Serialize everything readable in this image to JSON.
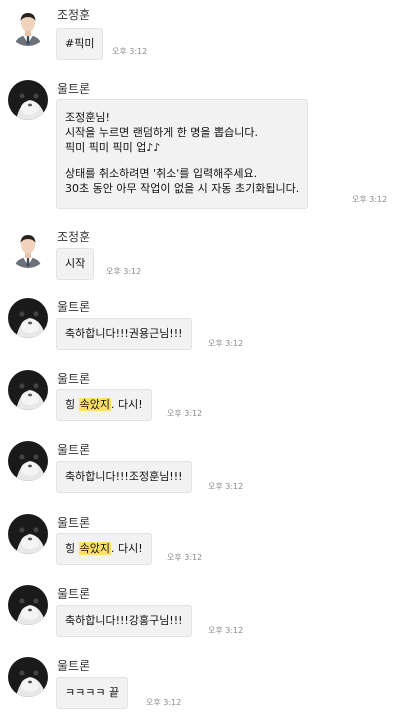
{
  "messages": [
    {
      "sender": "조정훈",
      "text": "#픽미",
      "time": "오후 3:12"
    },
    {
      "sender": "울트론",
      "lines": [
        "조정훈님!",
        "시작을 누르면 랜덤하게 한 명을 뽑습니다.",
        "픽미 픽미 픽미 업♪♪",
        "",
        "상태를 취소하려면 '취소'를 입력해주세요.",
        "30초 동안 아무 작업이 없을 시 자동 초기화됩니다."
      ],
      "time": "오후 3:12"
    },
    {
      "sender": "조정훈",
      "text": "시작",
      "time": "오후 3:12"
    },
    {
      "sender": "울트론",
      "text": "축하합니다!!!권용근님!!!",
      "time": "오후 3:12"
    },
    {
      "sender": "울트론",
      "pre": "힝 ",
      "highlight": "속았지",
      "post": ". 다시!",
      "time": "오후 3:12"
    },
    {
      "sender": "울트론",
      "text": "축하합니다!!!조정훈님!!!",
      "time": "오후 3:12"
    },
    {
      "sender": "울트론",
      "pre": "힝 ",
      "highlight": "속았지",
      "post": ". 다시!",
      "time": "오후 3:12"
    },
    {
      "sender": "울트론",
      "text": "축하합니다!!!강홍구님!!!",
      "time": "오후 3:12"
    },
    {
      "sender": "울트론",
      "text": "ㅋㅋㅋㅋ 끝",
      "time": "오후 3:12"
    }
  ],
  "avatars": {
    "user": {
      "icon": "person-avatar-icon",
      "shirt": "#ffffff",
      "suit": "#6b7079",
      "tie": "#3b4a5c",
      "hair": "#2a2420",
      "skin": "#f1d2bc"
    },
    "bot": {
      "icon": "cat-avatar-icon",
      "fur_dark": "#1a1a1a",
      "fur_light": "#e8e8e8"
    }
  }
}
